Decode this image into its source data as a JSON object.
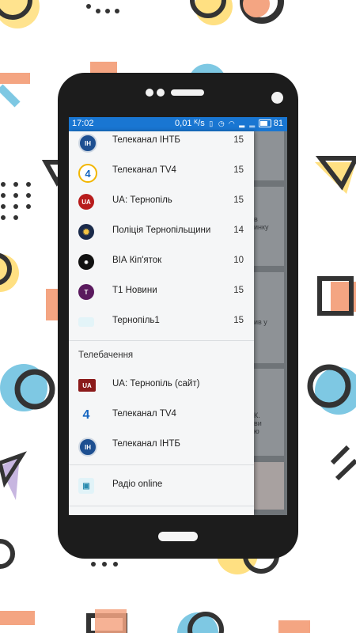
{
  "status_bar": {
    "time": "17:02",
    "speed": "0,01 ᴷ/s",
    "battery": "81"
  },
  "drawer": {
    "channels": [
      {
        "label": "Телеканал ІНТБ",
        "count": "15",
        "icon": "intb-logo-icon"
      },
      {
        "label": "Телеканал TV4",
        "count": "15",
        "icon": "tv4-logo-icon"
      },
      {
        "label": "UA: Тернопіль",
        "count": "15",
        "icon": "ua-ternopil-logo-icon"
      },
      {
        "label": "Поліція Тернопільщини",
        "count": "14",
        "icon": "police-logo-icon"
      },
      {
        "label": "ВІА Кіп'яток",
        "count": "10",
        "icon": "via-kipiatok-logo-icon"
      },
      {
        "label": "Т1 Новини",
        "count": "15",
        "icon": "t1-logo-icon"
      },
      {
        "label": "Тернопіль1",
        "count": "15",
        "icon": "ternopil1-logo-icon"
      }
    ],
    "tv_section_title": "Телебачення",
    "tv": [
      {
        "label": "UA: Тернопіль (сайт)",
        "icon": "ua-ternopil-site-logo-icon"
      },
      {
        "label": "Телеканал TV4",
        "icon": "tv4-logo-icon"
      },
      {
        "label": "Телеканал ІНТБ",
        "icon": "intb-logo-icon"
      }
    ],
    "radio": {
      "label": "Радіо online",
      "icon": "radio-icon"
    }
  },
  "behind_cards": [
    {
      "text": ""
    },
    {
      "text": "в\nинку"
    },
    {
      "text": "ив у"
    },
    {
      "text": "К.\nви\nю"
    }
  ]
}
